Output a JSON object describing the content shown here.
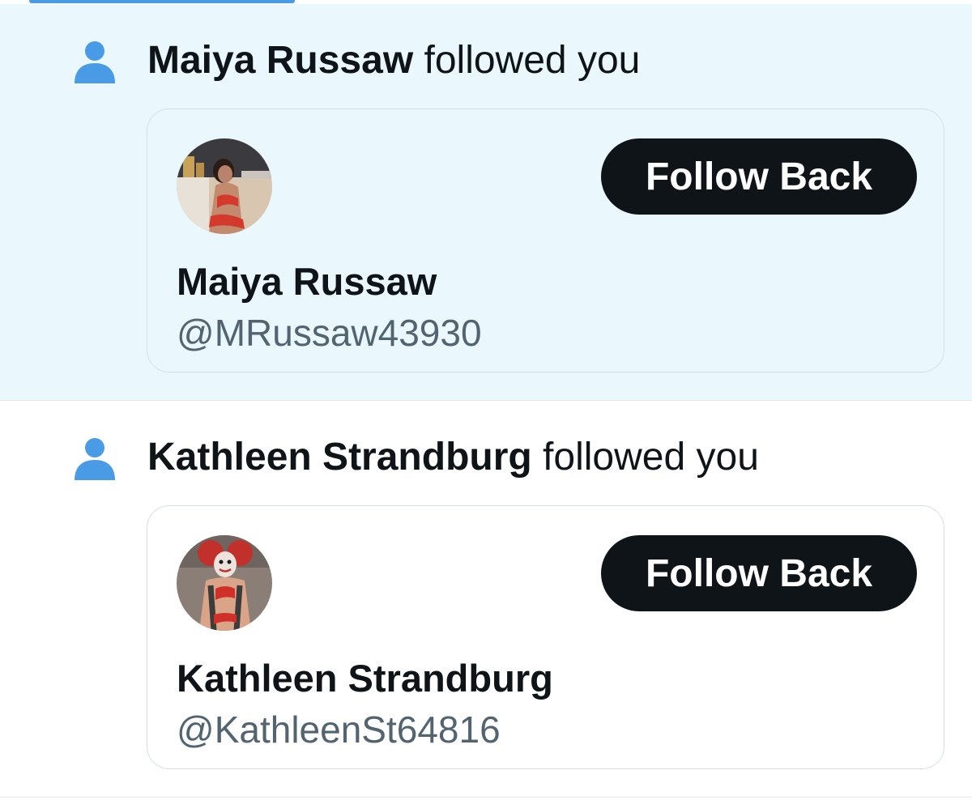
{
  "notifications": [
    {
      "actor": "Maiya Russaw",
      "verb": "followed you",
      "icon": "person-icon",
      "state": "unread",
      "card": {
        "display_name": "Maiya Russaw",
        "handle": "@MRussaw43930",
        "button_label": "Follow Back"
      }
    },
    {
      "actor": "Kathleen Strandburg",
      "verb": "followed you",
      "icon": "person-icon",
      "state": "read",
      "card": {
        "display_name": "Kathleen Strandburg",
        "handle": "@KathleenSt64816",
        "button_label": "Follow Back"
      }
    }
  ],
  "colors": {
    "accent": "#4a9be6",
    "unread_bg": "#eaf8fd",
    "button_bg": "#0f1419",
    "handle_text": "#536471"
  }
}
